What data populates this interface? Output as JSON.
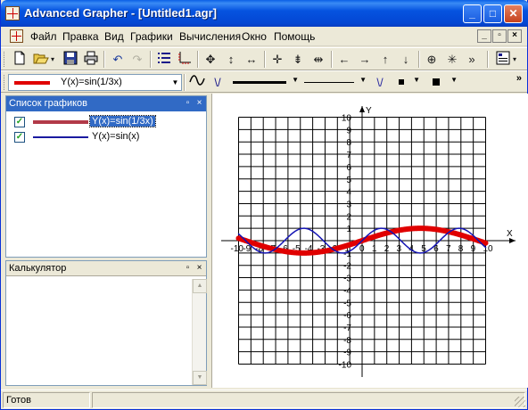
{
  "window": {
    "title": "Advanced Grapher - [Untitled1.agr]",
    "buttons": {
      "minimize": "_",
      "maximize": "□",
      "close": "✕"
    }
  },
  "menubar": {
    "items": [
      "Файл",
      "Правка",
      "Вид",
      "Графики",
      "Вычисления",
      "Окно",
      "Помощь"
    ],
    "mdi_buttons": {
      "minimize": "_",
      "restore": "▫",
      "close": "×"
    }
  },
  "toolbar1": {
    "icons": [
      "new-icon",
      "open-icon",
      "save-icon",
      "print-icon",
      "undo-icon",
      "redo-icon",
      "graph-list-icon",
      "axes-icon",
      "move-icon",
      "stretch-vertical-icon",
      "stretch-horizontal-icon",
      "zoom-in-icon",
      "compress-vertical-icon",
      "compress-horizontal-icon",
      "arrow-left-icon",
      "arrow-right-icon",
      "arrow-up-icon",
      "arrow-down-icon",
      "trace-icon",
      "star-icon",
      "properties-icon"
    ],
    "overflow": "»"
  },
  "toolbar2": {
    "graph_selector": {
      "value": "Y(x)=sin(1/3x)",
      "swatch_color": "#e00000"
    },
    "overflow": "»"
  },
  "graph_list_panel": {
    "title": "Список графиков",
    "items": [
      {
        "label": "Y(x)=sin(1/3x)",
        "checked": true,
        "color": "#b23a48",
        "selected": true
      },
      {
        "label": "Y(x)=sin(x)",
        "checked": true,
        "color": "#1a1aa0",
        "selected": false
      }
    ]
  },
  "calculator_panel": {
    "title": "Калькулятор"
  },
  "plot": {
    "axis_x_label": "X",
    "axis_y_label": "Y",
    "x_ticks": [
      "-10",
      "-9",
      "-8",
      "-7",
      "-6",
      "-5",
      "-4",
      "-3",
      "-2",
      "-1",
      "0",
      "1",
      "2",
      "3",
      "4",
      "5",
      "6",
      "7",
      "8",
      "9",
      "10"
    ],
    "y_ticks": [
      "10",
      "9",
      "8",
      "7",
      "6",
      "5",
      "4",
      "3",
      "2",
      "1",
      "-1",
      "-2",
      "-3",
      "-4",
      "-5",
      "-6",
      "-7",
      "-8",
      "-9",
      "-10"
    ]
  },
  "chart_data": {
    "type": "line",
    "xlim": [
      -10,
      10
    ],
    "ylim": [
      -10,
      10
    ],
    "xlabel": "X",
    "ylabel": "Y",
    "grid": true,
    "series": [
      {
        "name": "Y(x)=sin(1/3x)",
        "function": "sin(x/3)",
        "color": "#e00000"
      },
      {
        "name": "Y(x)=sin(x)",
        "function": "sin(x)",
        "color": "#1414b4"
      }
    ]
  },
  "statusbar": {
    "text": "Готов"
  }
}
